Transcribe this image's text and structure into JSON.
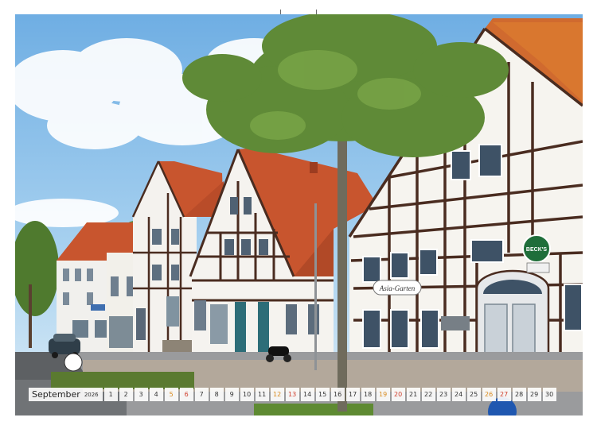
{
  "calendar": {
    "month": "September",
    "year": "2026",
    "days": [
      {
        "n": "1",
        "type": "weekday"
      },
      {
        "n": "2",
        "type": "weekday"
      },
      {
        "n": "3",
        "type": "weekday"
      },
      {
        "n": "4",
        "type": "weekday"
      },
      {
        "n": "5",
        "type": "sat"
      },
      {
        "n": "6",
        "type": "sun"
      },
      {
        "n": "7",
        "type": "weekday"
      },
      {
        "n": "8",
        "type": "weekday"
      },
      {
        "n": "9",
        "type": "weekday"
      },
      {
        "n": "10",
        "type": "weekday"
      },
      {
        "n": "11",
        "type": "weekday"
      },
      {
        "n": "12",
        "type": "sat"
      },
      {
        "n": "13",
        "type": "sun"
      },
      {
        "n": "14",
        "type": "weekday"
      },
      {
        "n": "15",
        "type": "weekday"
      },
      {
        "n": "16",
        "type": "weekday"
      },
      {
        "n": "17",
        "type": "weekday"
      },
      {
        "n": "18",
        "type": "weekday"
      },
      {
        "n": "19",
        "type": "sat"
      },
      {
        "n": "20",
        "type": "sun"
      },
      {
        "n": "21",
        "type": "weekday"
      },
      {
        "n": "22",
        "type": "weekday"
      },
      {
        "n": "23",
        "type": "weekday"
      },
      {
        "n": "24",
        "type": "weekday"
      },
      {
        "n": "25",
        "type": "weekday"
      },
      {
        "n": "26",
        "type": "sat"
      },
      {
        "n": "27",
        "type": "sun"
      },
      {
        "n": "28",
        "type": "weekday"
      },
      {
        "n": "29",
        "type": "weekday"
      },
      {
        "n": "30",
        "type": "weekday"
      }
    ]
  },
  "signs": {
    "beer": "BECK'S",
    "restaurant": "Asia-Garten"
  },
  "colors": {
    "sky": "#8fc3ea",
    "roof": "#c8552e",
    "timber": "#4a2c20",
    "plaster": "#f3f1ec",
    "foliage": "#5f8a37",
    "saturday": "#d98b1f",
    "sunday": "#d0402e"
  }
}
